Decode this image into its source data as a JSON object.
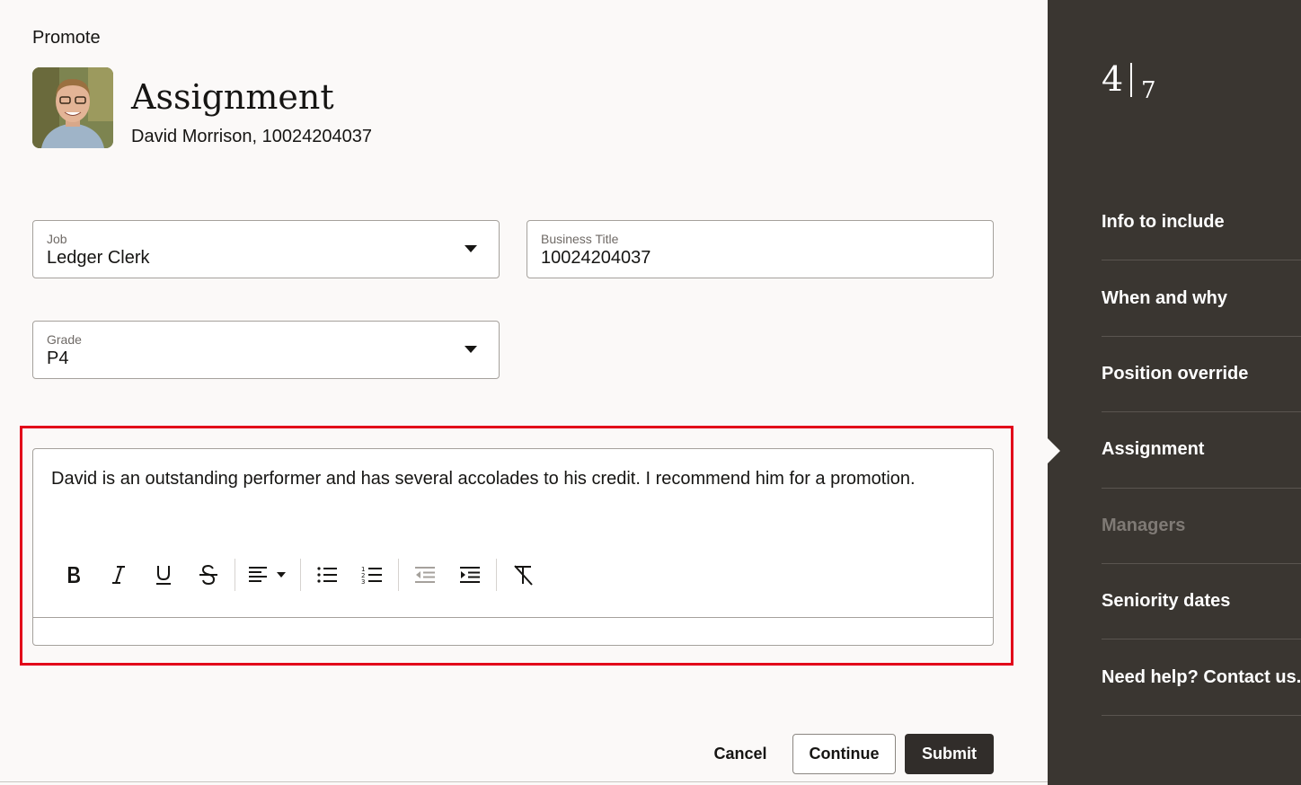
{
  "header": {
    "title": "Promote"
  },
  "person": {
    "section_title": "Assignment",
    "subtitle": "David Morrison, 10024204037"
  },
  "fields": {
    "job": {
      "label": "Job",
      "value": "Ledger Clerk"
    },
    "business_title": {
      "label": "Business Title",
      "value": "10024204037"
    },
    "grade": {
      "label": "Grade",
      "value": "P4"
    }
  },
  "editor": {
    "text": "David is an outstanding performer and has several accolades to his credit. I recommend him for a promotion.",
    "toolbar": [
      "bold-icon",
      "italic-icon",
      "underline-icon",
      "strikethrough-icon",
      "align-left-icon",
      "chevron-down-icon",
      "bullet-list-icon",
      "numbered-list-icon",
      "outdent-icon",
      "indent-icon",
      "clear-formatting-icon"
    ]
  },
  "actions": {
    "cancel": "Cancel",
    "continue": "Continue",
    "submit": "Submit"
  },
  "progress": {
    "current": "4",
    "total": "7"
  },
  "steps": [
    {
      "label": "Info to include",
      "enabled": true
    },
    {
      "label": "When and why",
      "enabled": true
    },
    {
      "label": "Position override",
      "enabled": true
    },
    {
      "label": "Assignment",
      "enabled": true,
      "current": true
    },
    {
      "label": "Managers",
      "enabled": false
    },
    {
      "label": "Seniority dates",
      "enabled": true
    },
    {
      "label": "Need help? Contact us.",
      "enabled": true
    }
  ],
  "colors": {
    "sidebar_bg": "#3a3631",
    "highlight": "#e2001a",
    "primary_button": "#312d2a"
  }
}
